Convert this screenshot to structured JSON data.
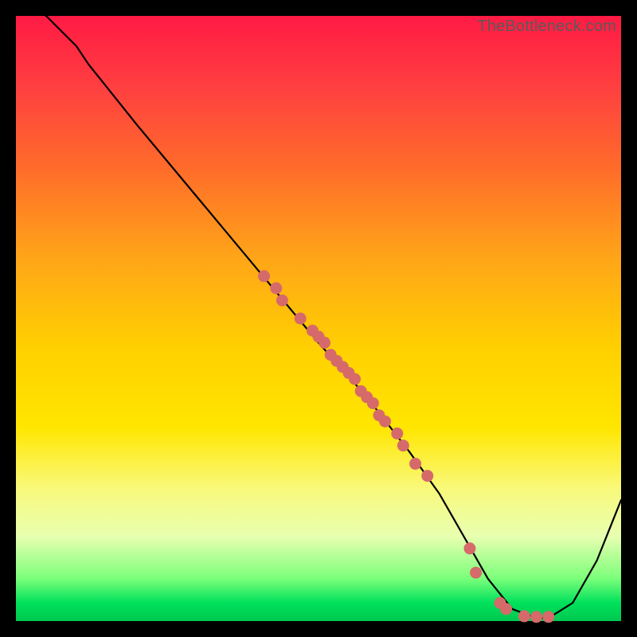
{
  "watermark": "TheBottleneck.com",
  "colors": {
    "curve": "#000000",
    "point": "#d66a6a"
  },
  "chart_data": {
    "type": "scatter",
    "title": "",
    "xlabel": "",
    "ylabel": "",
    "xlim": [
      0,
      100
    ],
    "ylim": [
      0,
      100
    ],
    "series": [
      {
        "name": "curve",
        "kind": "line",
        "x": [
          0,
          5,
          10,
          12,
          20,
          30,
          40,
          50,
          58,
          65,
          70,
          74,
          78,
          82,
          86,
          88,
          92,
          96,
          100
        ],
        "y": [
          103,
          100,
          95,
          92,
          82,
          70,
          58,
          46,
          37,
          28,
          21,
          14,
          7,
          2,
          0.5,
          0.5,
          3,
          10,
          20
        ]
      },
      {
        "name": "points",
        "kind": "scatter",
        "x": [
          41,
          43,
          44,
          47,
          49,
          50,
          51,
          52,
          53,
          54,
          55,
          56,
          57,
          58,
          59,
          60,
          61,
          63,
          64,
          66,
          68,
          75,
          76,
          80,
          81,
          84,
          86,
          88
        ],
        "y": [
          57,
          55,
          53,
          50,
          48,
          47,
          46,
          44,
          43,
          42,
          41,
          40,
          38,
          37,
          36,
          34,
          33,
          31,
          29,
          26,
          24,
          12,
          8,
          3,
          2,
          0.8,
          0.7,
          0.7
        ]
      }
    ]
  }
}
